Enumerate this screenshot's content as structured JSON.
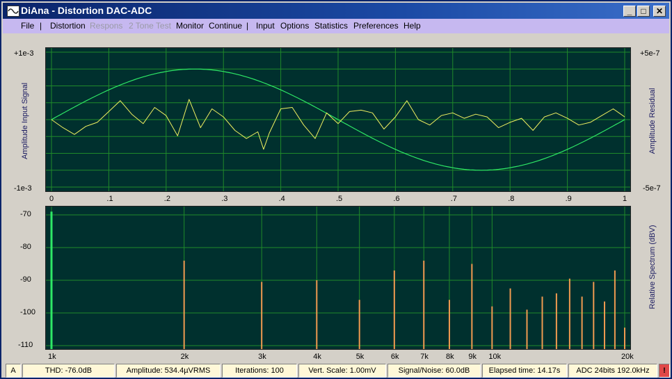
{
  "window": {
    "title": "DiAna - Distortion DAC-ADC",
    "minimize_label": "_",
    "maximize_label": "□",
    "close_label": "✕"
  },
  "menu": {
    "file": "File",
    "sep1": "|",
    "distortion": "Distortion",
    "respons": "Respons",
    "two_tone_test": "2 Tone Test",
    "monitor": "Monitor",
    "continue": "Continue",
    "sep2": "|",
    "input": "Input",
    "options": "Options",
    "statistics": "Statistics",
    "preferences": "Preferences",
    "help": "Help"
  },
  "time_plot": {
    "left_axis_title": "Amplitude Input Signal",
    "right_axis_title": "Amplitude Residual",
    "left_top": "+1e-3",
    "left_bottom": "-1e-3",
    "right_top": "+5e-7",
    "right_bottom": "-5e-7",
    "x_ticks": [
      "0",
      ".1",
      ".2",
      ".3",
      ".4",
      ".5",
      ".6",
      ".7",
      ".8",
      ".9",
      "1"
    ],
    "signal_color": "#2ee866",
    "residual_color": "#f0f060",
    "grid_color": "#1f8a2a"
  },
  "spectrum_plot": {
    "right_axis_title": "Relative Spectrum (dBV)",
    "y_ticks": [
      "-70",
      "-80",
      "-90",
      "-100",
      "-110"
    ],
    "x_ticks": [
      "1k",
      "2k",
      "3k",
      "4k",
      "5k",
      "6k",
      "7k",
      "8k",
      "9k",
      "10k",
      "20k"
    ],
    "bar_color": "#f09a50",
    "fundamental_color": "#2ee866"
  },
  "chart_data": [
    {
      "type": "line",
      "title": "",
      "xlabel": "",
      "ylabel": "Amplitude Input Signal",
      "xlim": [
        0,
        1
      ],
      "ylim": [
        -0.001,
        0.001
      ],
      "series": [
        {
          "name": "",
          "function": "sine",
          "amplitude": 0.00075,
          "periods": 1
        },
        {
          "name": "",
          "axis": "right",
          "ylim": [
            -5e-07,
            5e-07
          ],
          "x": [
            0,
            0.02,
            0.04,
            0.06,
            0.08,
            0.1,
            0.12,
            0.14,
            0.16,
            0.18,
            0.2,
            0.22,
            0.24,
            0.26,
            0.28,
            0.3,
            0.32,
            0.34,
            0.36,
            0.37,
            0.38,
            0.4,
            0.42,
            0.44,
            0.46,
            0.48,
            0.5,
            0.52,
            0.54,
            0.56,
            0.58,
            0.6,
            0.62,
            0.64,
            0.66,
            0.68,
            0.7,
            0.72,
            0.74,
            0.76,
            0.78,
            0.8,
            0.82,
            0.84,
            0.86,
            0.88,
            0.9,
            0.92,
            0.94,
            0.96,
            0.98,
            1.0
          ],
          "y": [
            0,
            -6e-08,
            -1.1e-07,
            -5e-08,
            -2e-08,
            6e-08,
            1.4e-07,
            4e-08,
            -3e-08,
            9e-08,
            3e-08,
            -1.2e-07,
            1.5e-07,
            -6e-08,
            8e-08,
            2e-08,
            -8e-08,
            -1.4e-07,
            -9e-08,
            -2.2e-07,
            -1e-07,
            8e-08,
            9e-08,
            -4e-08,
            -1.4e-07,
            5e-08,
            -3e-08,
            6e-08,
            7e-08,
            5e-08,
            -7e-08,
            2e-08,
            1.4e-07,
            0.0,
            -4e-08,
            3e-08,
            5e-08,
            1e-08,
            4e-08,
            2e-08,
            -6e-08,
            -2e-08,
            1e-08,
            -8e-08,
            2e-08,
            5e-08,
            1e-08,
            -4e-08,
            -2e-08,
            3e-08,
            8e-08,
            2e-08
          ]
        }
      ]
    },
    {
      "type": "bar",
      "title": "",
      "xlabel": "",
      "ylabel": "Relative Spectrum (dBV)",
      "xscale": "log",
      "xlim": [
        1000,
        20000
      ],
      "ylim": [
        -110,
        -69
      ],
      "series": [
        {
          "name": "",
          "x": [
            1000,
            2000,
            3000,
            4000,
            5000,
            6000,
            7000,
            8000,
            9000,
            10000,
            11000,
            12000,
            13000,
            14000,
            15000,
            16000,
            17000,
            18000,
            19000,
            20000
          ],
          "y": [
            -69,
            -84,
            -90.5,
            -90,
            -96,
            -87,
            -84,
            -96,
            -85,
            -98,
            -92.5,
            -99,
            -95,
            -94,
            -89.5,
            -95,
            -90.5,
            -96.5,
            -87,
            -104.5
          ]
        }
      ]
    }
  ],
  "status": {
    "a": "A",
    "thd": "THD:  -76.0dB",
    "amplitude": "Amplitude: 534.4µVRMS",
    "iterations": "Iterations: 100",
    "vert_scale": "Vert. Scale: 1.00mV",
    "snr": "Signal/Noise:   60.0dB",
    "elapsed": "Elapsed time: 14.17s",
    "adc": "ADC 24bits 192.0kHz",
    "alert": "!",
    "alert_color": "#e04848"
  }
}
